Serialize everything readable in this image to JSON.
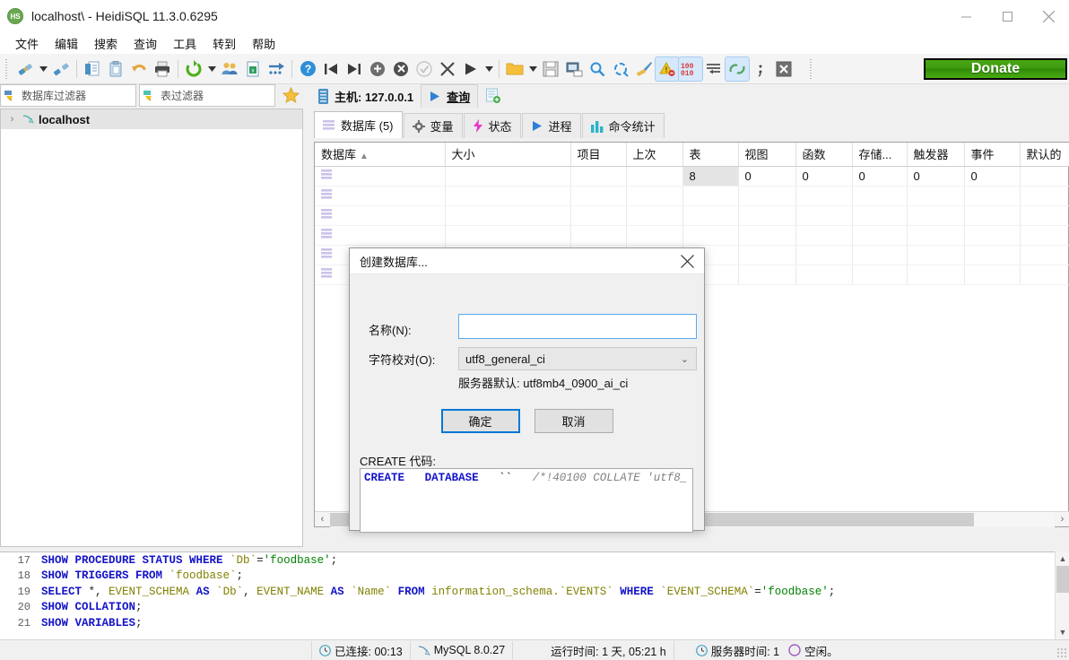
{
  "window": {
    "title": "localhost\\ - HeidiSQL 11.3.0.6295",
    "app_badge": "HS",
    "minimize": "minimize-icon",
    "maximize": "maximize-icon",
    "close": "close-icon"
  },
  "menu": {
    "items": [
      "文件",
      "编辑",
      "搜索",
      "查询",
      "工具",
      "转到",
      "帮助"
    ]
  },
  "toolbar": {
    "donate_label": "Donate",
    "buttons": [
      "connect-icon",
      "connect-dropdown",
      "disconnect-icon",
      "new-query-icon",
      "paste-icon",
      "undo-icon",
      "print-icon",
      "refresh-icon",
      "refresh-dropdown",
      "users-icon",
      "export-grid-icon",
      "import-icon",
      "help-icon",
      "first-icon",
      "last-icon",
      "insert-row-icon",
      "delete-row-icon",
      "commit-icon",
      "cancel-icon",
      "run-icon",
      "run-dropdown",
      "open-folder-icon",
      "open-dropdown",
      "save-icon",
      "save-as-icon",
      "find-icon",
      "replace-icon",
      "format-icon",
      "warning-icon",
      "binary-icon",
      "wrap-icon",
      "run-selection-icon",
      "semicolon-icon",
      "stop-icon"
    ]
  },
  "left": {
    "db_filter_placeholder": "数据库过滤器",
    "table_filter_placeholder": "表过滤器",
    "star": "star-icon",
    "tree": [
      {
        "label": "localhost",
        "expander": "›"
      }
    ]
  },
  "right": {
    "host_tab": {
      "label": "主机: 127.0.0.1",
      "icon": "server-icon"
    },
    "query_tab": {
      "label": "查询",
      "icon": "play-icon"
    },
    "new_tab_icon": "new-query-tab-icon",
    "subtabs": [
      {
        "label": "数据库 (5)",
        "icon": "database-icon",
        "active": true
      },
      {
        "label": "变量",
        "icon": "gear-icon",
        "active": false
      },
      {
        "label": "状态",
        "icon": "lightning-icon",
        "active": false
      },
      {
        "label": "进程",
        "icon": "play-icon",
        "active": false
      },
      {
        "label": "命令统计",
        "icon": "bar-chart-icon",
        "active": false
      }
    ],
    "grid": {
      "columns": [
        "数据库",
        "大小",
        "项目",
        "上次",
        "表",
        "视图",
        "函数",
        "存储...",
        "触发器",
        "事件",
        "默认的"
      ],
      "sort_arrow": "▲",
      "rows": [
        {
          "cells": [
            "",
            "",
            "",
            "",
            "8",
            "0",
            "0",
            "0",
            "0",
            "0",
            ""
          ]
        },
        {
          "cells": [
            "",
            "",
            "",
            "",
            "",
            "",
            "",
            "",
            "",
            "",
            ""
          ]
        },
        {
          "cells": [
            "",
            "",
            "",
            "",
            "",
            "",
            "",
            "",
            "",
            "",
            ""
          ]
        },
        {
          "cells": [
            "",
            "",
            "",
            "",
            "",
            "",
            "",
            "",
            "",
            "",
            ""
          ]
        },
        {
          "cells": [
            "",
            "",
            "",
            "",
            "",
            "",
            "",
            "",
            "",
            "",
            ""
          ]
        },
        {
          "cells": [
            "",
            "",
            "",
            "",
            "",
            "",
            "",
            "",
            "",
            "",
            ""
          ]
        }
      ]
    },
    "hscroll": {
      "left_arrow": "‹",
      "right_arrow": "›"
    }
  },
  "dialog": {
    "title": "创建数据库...",
    "close_icon": "close-icon",
    "name_label": "名称(N):",
    "name_value": "",
    "collation_label": "字符校对(O):",
    "collation_value": "utf8_general_ci",
    "server_default_hint": "服务器默认: utf8mb4_0900_ai_ci",
    "ok_label": "确定",
    "cancel_label": "取消",
    "create_code_label": "CREATE 代码:",
    "create_code": {
      "kw1": "CREATE",
      "kw2": "DATABASE",
      "ident": "``",
      "comment": "/*!40100 COLLATE 'utf8_"
    }
  },
  "log": {
    "lines": [
      {
        "num": "17",
        "parts": [
          {
            "t": "SHOW PROCEDURE STATUS WHERE ",
            "c": "kw"
          },
          {
            "t": "`Db`",
            "c": "id"
          },
          {
            "t": "=",
            "c": "plain"
          },
          {
            "t": "'foodbase'",
            "c": "str"
          },
          {
            "t": ";",
            "c": "plain"
          }
        ]
      },
      {
        "num": "18",
        "parts": [
          {
            "t": "SHOW TRIGGERS FROM ",
            "c": "kw"
          },
          {
            "t": "`foodbase`",
            "c": "id"
          },
          {
            "t": ";",
            "c": "plain"
          }
        ]
      },
      {
        "num": "19",
        "parts": [
          {
            "t": "SELECT ",
            "c": "kw"
          },
          {
            "t": "*, ",
            "c": "plain"
          },
          {
            "t": "EVENT_SCHEMA ",
            "c": "id"
          },
          {
            "t": "AS ",
            "c": "kw"
          },
          {
            "t": "`Db`",
            "c": "id"
          },
          {
            "t": ", ",
            "c": "plain"
          },
          {
            "t": "EVENT_NAME ",
            "c": "id"
          },
          {
            "t": "AS ",
            "c": "kw"
          },
          {
            "t": "`Name` ",
            "c": "id"
          },
          {
            "t": "FROM ",
            "c": "kw"
          },
          {
            "t": "information_schema.`EVENTS` ",
            "c": "id"
          },
          {
            "t": "WHERE ",
            "c": "kw"
          },
          {
            "t": "`EVENT_SCHEMA`",
            "c": "id"
          },
          {
            "t": "=",
            "c": "plain"
          },
          {
            "t": "'foodbase'",
            "c": "str"
          },
          {
            "t": ";",
            "c": "plain"
          }
        ]
      },
      {
        "num": "20",
        "parts": [
          {
            "t": "SHOW COLLATION",
            "c": "kw"
          },
          {
            "t": ";",
            "c": "plain"
          }
        ]
      },
      {
        "num": "21",
        "parts": [
          {
            "t": "SHOW VARIABLES",
            "c": "kw"
          },
          {
            "t": ";",
            "c": "plain"
          }
        ]
      }
    ]
  },
  "status": {
    "connected": "已连接: 00:13",
    "server": "MySQL 8.0.27",
    "uptime": "运行时间: 1 天, 05:21 h",
    "server_time": "服务器时间: 1",
    "idle": "空闲。",
    "clock_icon": "clock-icon",
    "dolphin_icon": "dolphin-icon",
    "server_clock_icon": "clock-icon",
    "idle_icon": "circle-icon"
  }
}
